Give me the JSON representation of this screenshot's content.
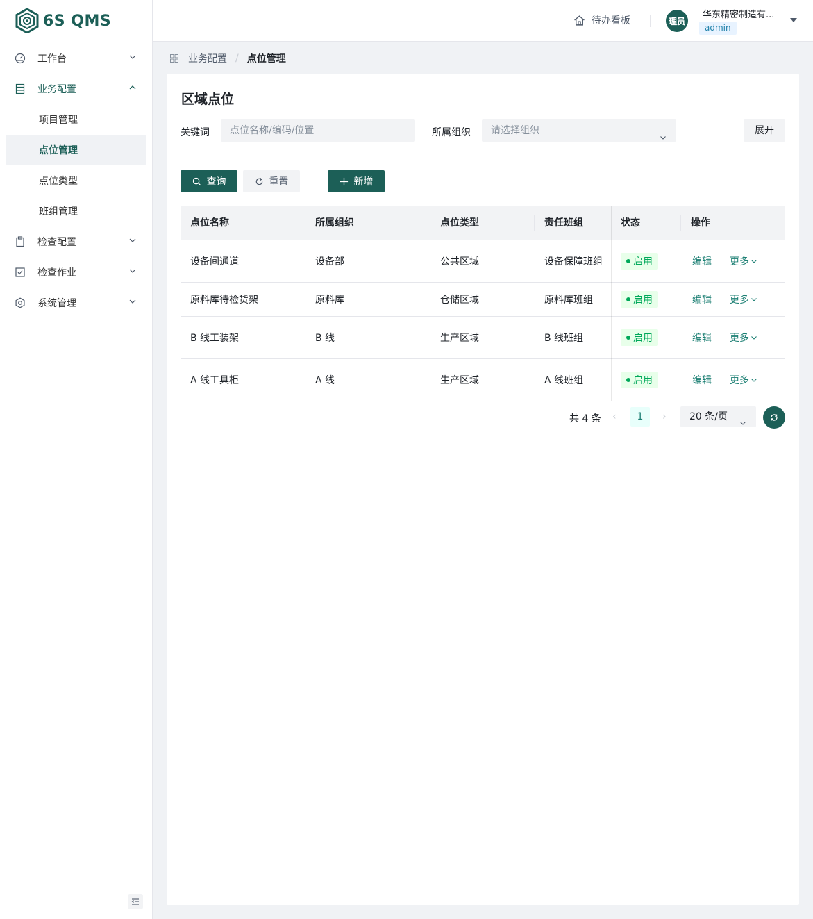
{
  "app": {
    "logo_text": "6S QMS"
  },
  "sidebar": {
    "items": [
      {
        "label": "工作台",
        "icon": "dashboard-icon",
        "expanded": false
      },
      {
        "label": "业务配置",
        "icon": "config-icon",
        "expanded": true,
        "children": [
          {
            "label": "项目管理"
          },
          {
            "label": "点位管理",
            "active": true
          },
          {
            "label": "点位类型"
          },
          {
            "label": "班组管理"
          }
        ]
      },
      {
        "label": "检查配置",
        "icon": "clipboard-icon",
        "expanded": false
      },
      {
        "label": "检查作业",
        "icon": "checkbox-icon",
        "expanded": false
      },
      {
        "label": "系统管理",
        "icon": "gear-icon",
        "expanded": false
      }
    ]
  },
  "header": {
    "todo_label": "待办看板",
    "avatar_text": "理员",
    "company": "华东精密制造有...",
    "role": "admin"
  },
  "breadcrumb": {
    "parent": "业务配置",
    "current": "点位管理"
  },
  "page": {
    "title": "区域点位",
    "filters": {
      "keyword_label": "关键词",
      "keyword_placeholder": "点位名称/编码/位置",
      "org_label": "所属组织",
      "org_placeholder": "请选择组织",
      "expand_label": "展开"
    },
    "actions": {
      "query": "查询",
      "reset": "重置",
      "add": "新增"
    },
    "table": {
      "headers": [
        "点位名称",
        "所属组织",
        "点位类型",
        "责任班组",
        "状态",
        "操作"
      ],
      "rows": [
        {
          "name": "设备间通道",
          "org": "设备部",
          "type": "公共区域",
          "team": "设备保障班组",
          "status": "启用"
        },
        {
          "name": "原料库待检货架",
          "org": "原料库",
          "type": "仓储区域",
          "team": "原料库班组",
          "status": "启用"
        },
        {
          "name": "B 线工装架",
          "org": "B 线",
          "type": "生产区域",
          "team": "B 线班组",
          "status": "启用"
        },
        {
          "name": "A 线工具柜",
          "org": "A 线",
          "type": "生产区域",
          "team": "A 线班组",
          "status": "启用"
        }
      ],
      "op_edit": "编辑",
      "op_more": "更多"
    },
    "pagination": {
      "total": "共 4 条",
      "prev": "‹",
      "current": "1",
      "next": "›",
      "page_size": "20 条/页"
    }
  },
  "colors": {
    "primary": "#1c5f57",
    "status_green": "#00a85a",
    "link": "#1c7f73"
  }
}
